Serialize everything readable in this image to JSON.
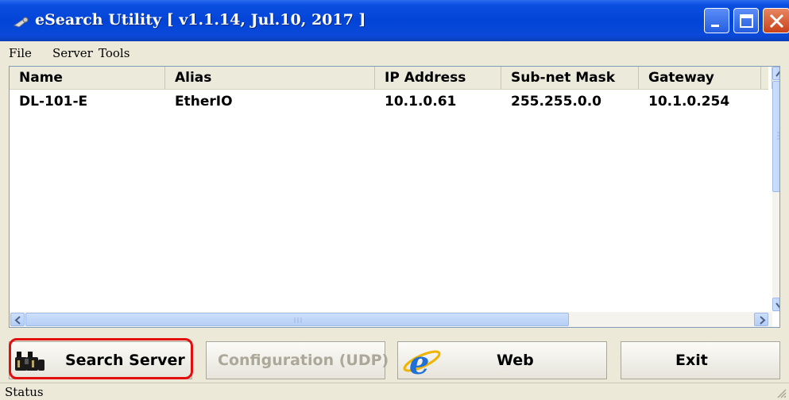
{
  "window": {
    "title": "eSearch Utility [ v1.1.14, Jul.10, 2017 ]"
  },
  "menu": [
    "File",
    "Server",
    "Tools"
  ],
  "table": {
    "columns": [
      "Name",
      "Alias",
      "IP Address",
      "Sub-net Mask",
      "Gateway"
    ],
    "rows": [
      [
        "DL-101-E",
        "EtherIO",
        "10.1.0.61",
        "255.255.0.0",
        "10.1.0.254"
      ]
    ]
  },
  "buttons": {
    "search_server": "Search Server",
    "configuration": "Configuration (UDP)",
    "web": "Web",
    "exit": "Exit"
  },
  "status": {
    "label": "Status"
  },
  "colors": {
    "titlebar": "#0344d7",
    "highlight": "#e30f0f",
    "close_button": "#c8421b"
  }
}
